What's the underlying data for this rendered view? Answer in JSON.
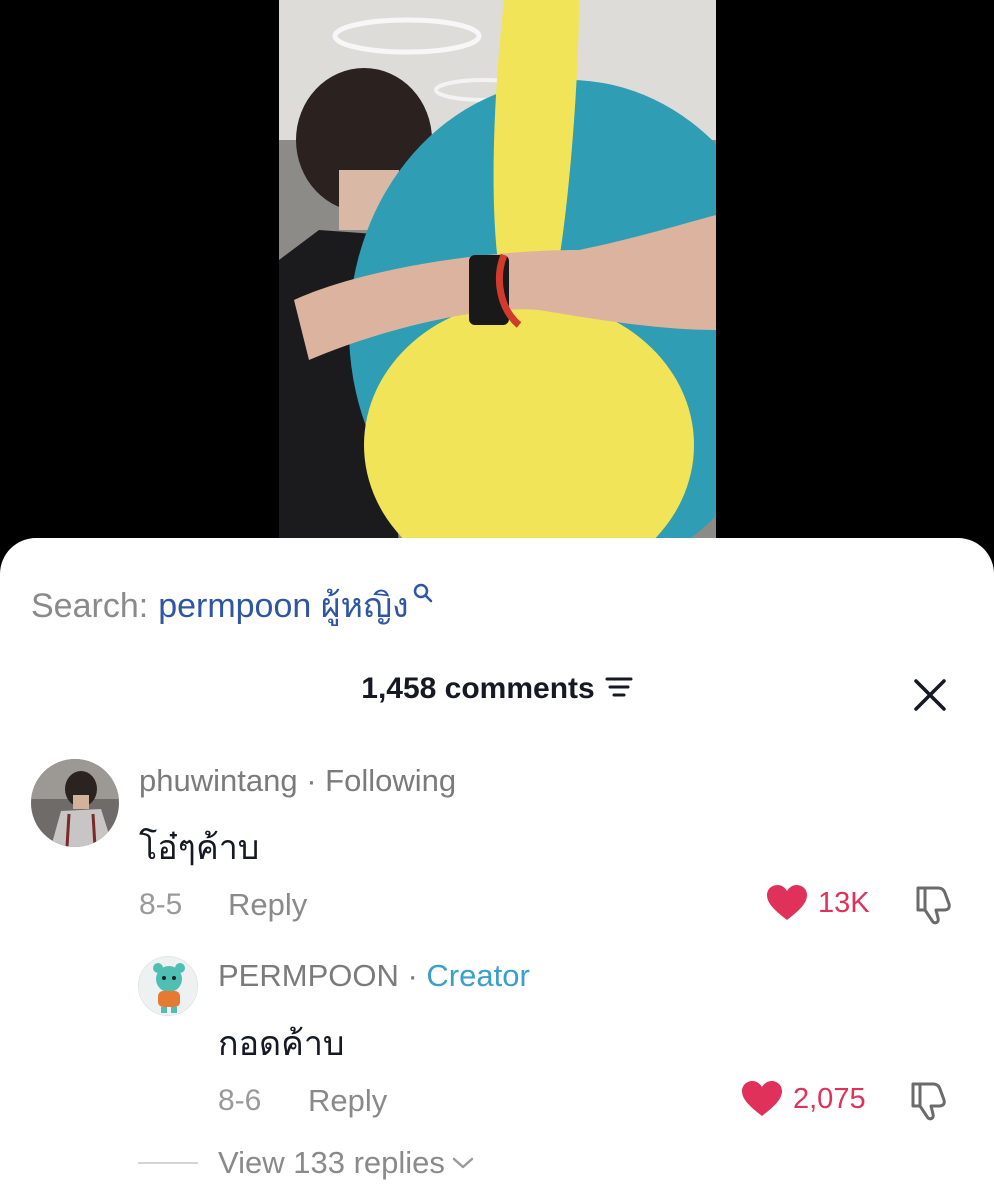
{
  "search": {
    "prefix": "Search:",
    "term": "permpoon ผู้หญิง"
  },
  "comments_header": {
    "count_label": "1,458 comments"
  },
  "comments": [
    {
      "username": "phuwintang",
      "relation": "· Following",
      "text": "โอ๋ๆค้าบ",
      "date": "8-5",
      "reply_label": "Reply",
      "likes": "13K"
    }
  ],
  "reply": {
    "username": "PERMPOON",
    "separator": " · ",
    "badge": "Creator",
    "text": "กอดค้าบ",
    "date": "8-6",
    "reply_label": "Reply",
    "likes": "2,075"
  },
  "view_replies": {
    "label": "View 133 replies"
  },
  "colors": {
    "like_red": "#e0315a",
    "link_blue": "#2f55a4",
    "creator_blue": "#3a9fc9"
  },
  "icons": {
    "search": "search-icon",
    "sort": "sort-icon",
    "close": "close-icon",
    "like": "heart-icon",
    "dislike": "thumbs-down-icon",
    "expand": "chevron-down-icon"
  }
}
